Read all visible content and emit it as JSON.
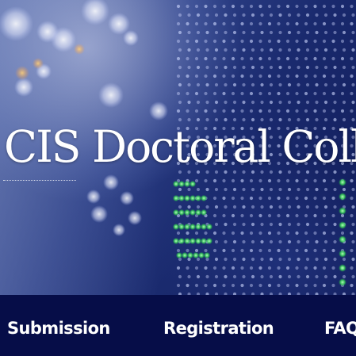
{
  "hero": {
    "title": "CIS Doctoral Collo",
    "background_description_icon": "stock-ticker-led-board-image"
  },
  "nav": {
    "items": [
      {
        "label": "Submission"
      },
      {
        "label": "Registration"
      },
      {
        "label": "FAQ"
      }
    ]
  },
  "colors": {
    "nav_background": "#060d48",
    "nav_text": "#ffffff",
    "title_text": "#ffffff",
    "led_green": "#4cff6a",
    "led_white": "#dfe6ff"
  }
}
